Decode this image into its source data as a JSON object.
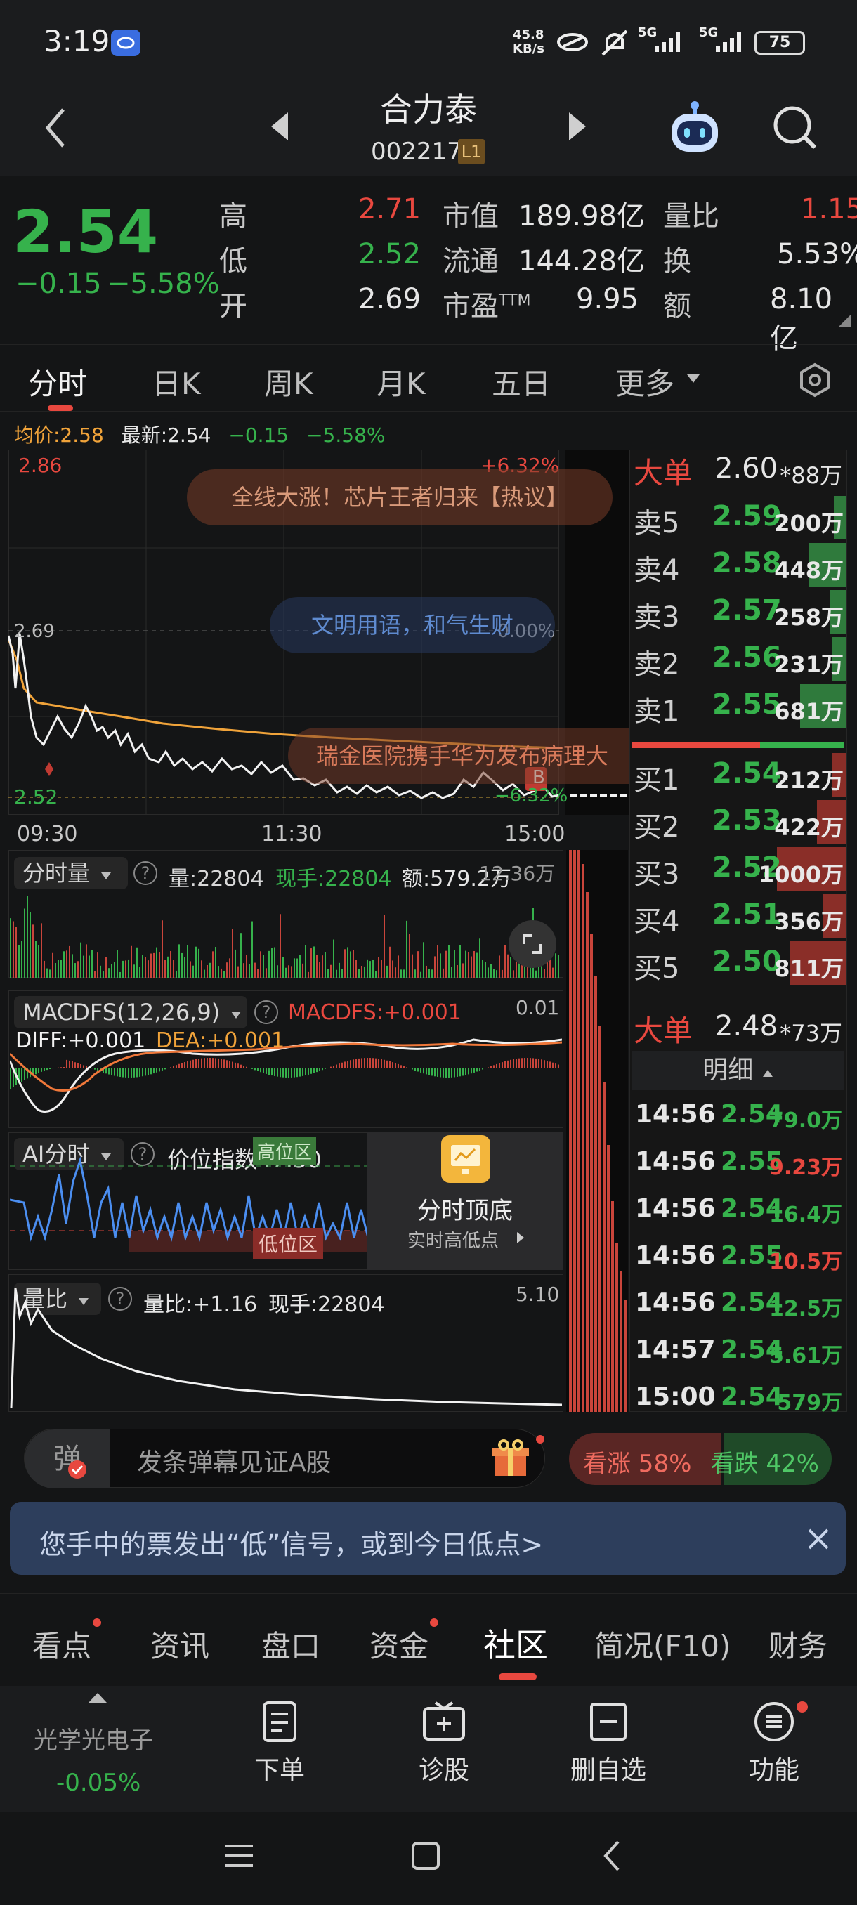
{
  "status_bar": {
    "time": "3:19",
    "net_speed_top": "45.8",
    "net_speed_bottom": "KB/s",
    "signal1": "5G",
    "signal2": "5G",
    "battery": "75"
  },
  "header": {
    "stock_name": "合力泰",
    "stock_code": "002217",
    "level_badge": "L1"
  },
  "quote": {
    "price": "2.54",
    "change": "−0.15",
    "change_pct": "−5.58%",
    "high_label": "高",
    "high": "2.71",
    "low_label": "低",
    "low": "2.52",
    "open_label": "开",
    "open": "2.69",
    "mktcap_label": "市值",
    "mktcap": "189.98亿",
    "float_label": "流通",
    "float": "144.28亿",
    "pe_label": "市盈",
    "pe_sup": "TTM",
    "pe": "9.95",
    "vol_ratio_label": "量比",
    "vol_ratio": "1.15",
    "turnover_label": "换",
    "turnover": "5.53%",
    "amount_label": "额",
    "amount": "8.10亿"
  },
  "chart_tabs": [
    "分时",
    "日K",
    "周K",
    "月K",
    "五日",
    "更多"
  ],
  "intraday": {
    "avg_label": "均价:2.58",
    "latest_label": "最新:2.54",
    "change": "−0.15",
    "change_pct": "−5.58%",
    "y_high": "2.86",
    "y_mid": "2.69",
    "y_low": "2.52",
    "pct_high": "+6.32%",
    "pct_mid": "0.00%",
    "pct_low": "−6.32%",
    "time_start": "09:30",
    "time_mid": "11:30",
    "time_end": "15:00",
    "marker_b": "B",
    "danmaku": [
      "全线大涨！芯片王者归来【热议】",
      "文明用语，和气生财",
      "瑞金医院携手华为发布病理大"
    ]
  },
  "volume_panel": {
    "selector": "分时量",
    "vol": "量:22804",
    "hand": "现手:22804",
    "amount": "额:579.2万",
    "max": "12.36万"
  },
  "macd_panel": {
    "selector": "MACDFS(12,26,9)",
    "macd": "MACDFS:+0.001",
    "diff": "DIFF:+0.001",
    "dea": "DEA:+0.001",
    "max": "0.01"
  },
  "ai_panel": {
    "selector": "AI分时",
    "index": "价位指数47.30",
    "high_zone": "高位区",
    "low_zone": "低位区",
    "promo_title": "分时顶底",
    "promo_sub": "实时高低点"
  },
  "ratio_panel": {
    "selector": "量比",
    "ratio": "量比:+1.16",
    "hand": "现手:22804",
    "max": "5.10"
  },
  "order_book": {
    "big_sell_label": "大单",
    "big_sell_price": "2.60",
    "big_sell_vol": "*88万",
    "asks": [
      {
        "label": "卖5",
        "price": "2.59",
        "vol": "200万",
        "fill": 0.05
      },
      {
        "label": "卖4",
        "price": "2.58",
        "vol": "448万",
        "fill": 0.18
      },
      {
        "label": "卖3",
        "price": "2.57",
        "vol": "258万",
        "fill": 0.08
      },
      {
        "label": "卖2",
        "price": "2.56",
        "vol": "231万",
        "fill": 0.07
      },
      {
        "label": "卖1",
        "price": "2.55",
        "vol": "681万",
        "fill": 0.22
      }
    ],
    "bids": [
      {
        "label": "买1",
        "price": "2.54",
        "vol": "212万",
        "fill": 0.07
      },
      {
        "label": "买2",
        "price": "2.53",
        "vol": "422万",
        "fill": 0.14
      },
      {
        "label": "买3",
        "price": "2.52",
        "vol": "1000万",
        "fill": 0.33
      },
      {
        "label": "买4",
        "price": "2.51",
        "vol": "356万",
        "fill": 0.11
      },
      {
        "label": "买5",
        "price": "2.50",
        "vol": "811万",
        "fill": 0.27
      }
    ],
    "big_buy_label": "大单",
    "big_buy_price": "2.48",
    "big_buy_vol": "*73万"
  },
  "ticks": {
    "header": "明细",
    "rows": [
      {
        "time": "14:56",
        "price": "2.54",
        "vol": "79.0万",
        "dir": "green"
      },
      {
        "time": "14:56",
        "price": "2.55",
        "vol": "9.23万",
        "dir": "red"
      },
      {
        "time": "14:56",
        "price": "2.54",
        "vol": "16.4万",
        "dir": "green"
      },
      {
        "time": "14:56",
        "price": "2.55",
        "vol": "10.5万",
        "dir": "red"
      },
      {
        "time": "14:56",
        "price": "2.54",
        "vol": "12.5万",
        "dir": "green"
      },
      {
        "time": "14:57",
        "price": "2.54",
        "vol": "5.61万",
        "dir": "green"
      },
      {
        "time": "15:00",
        "price": "2.54",
        "vol": "579万",
        "dir": "green"
      }
    ]
  },
  "danmaku_bar": {
    "toggle_label": "弹",
    "placeholder": "发条弹幕见证A股",
    "bull": "看涨 58%",
    "bear": "看跌 42%",
    "bull_ratio": 0.58
  },
  "banner": {
    "text": "您手中的票发出“低”信号，或到今日低点>"
  },
  "info_tabs": [
    "看点",
    "资讯",
    "盘口",
    "资金",
    "社区",
    "简况(F10)",
    "财务"
  ],
  "info_tabs_active": 4,
  "bottom_bar": {
    "sector_name": "光学光电子",
    "sector_change": "-0.05%",
    "order": "下单",
    "diagnose": "诊股",
    "remove_fav": "删自选",
    "functions": "功能"
  },
  "colors": {
    "up": "#e8483f",
    "down": "#36b24c",
    "avg_line": "#f0a33a",
    "accent": "#e8483f",
    "banner_bg": "#2d3e5c"
  }
}
